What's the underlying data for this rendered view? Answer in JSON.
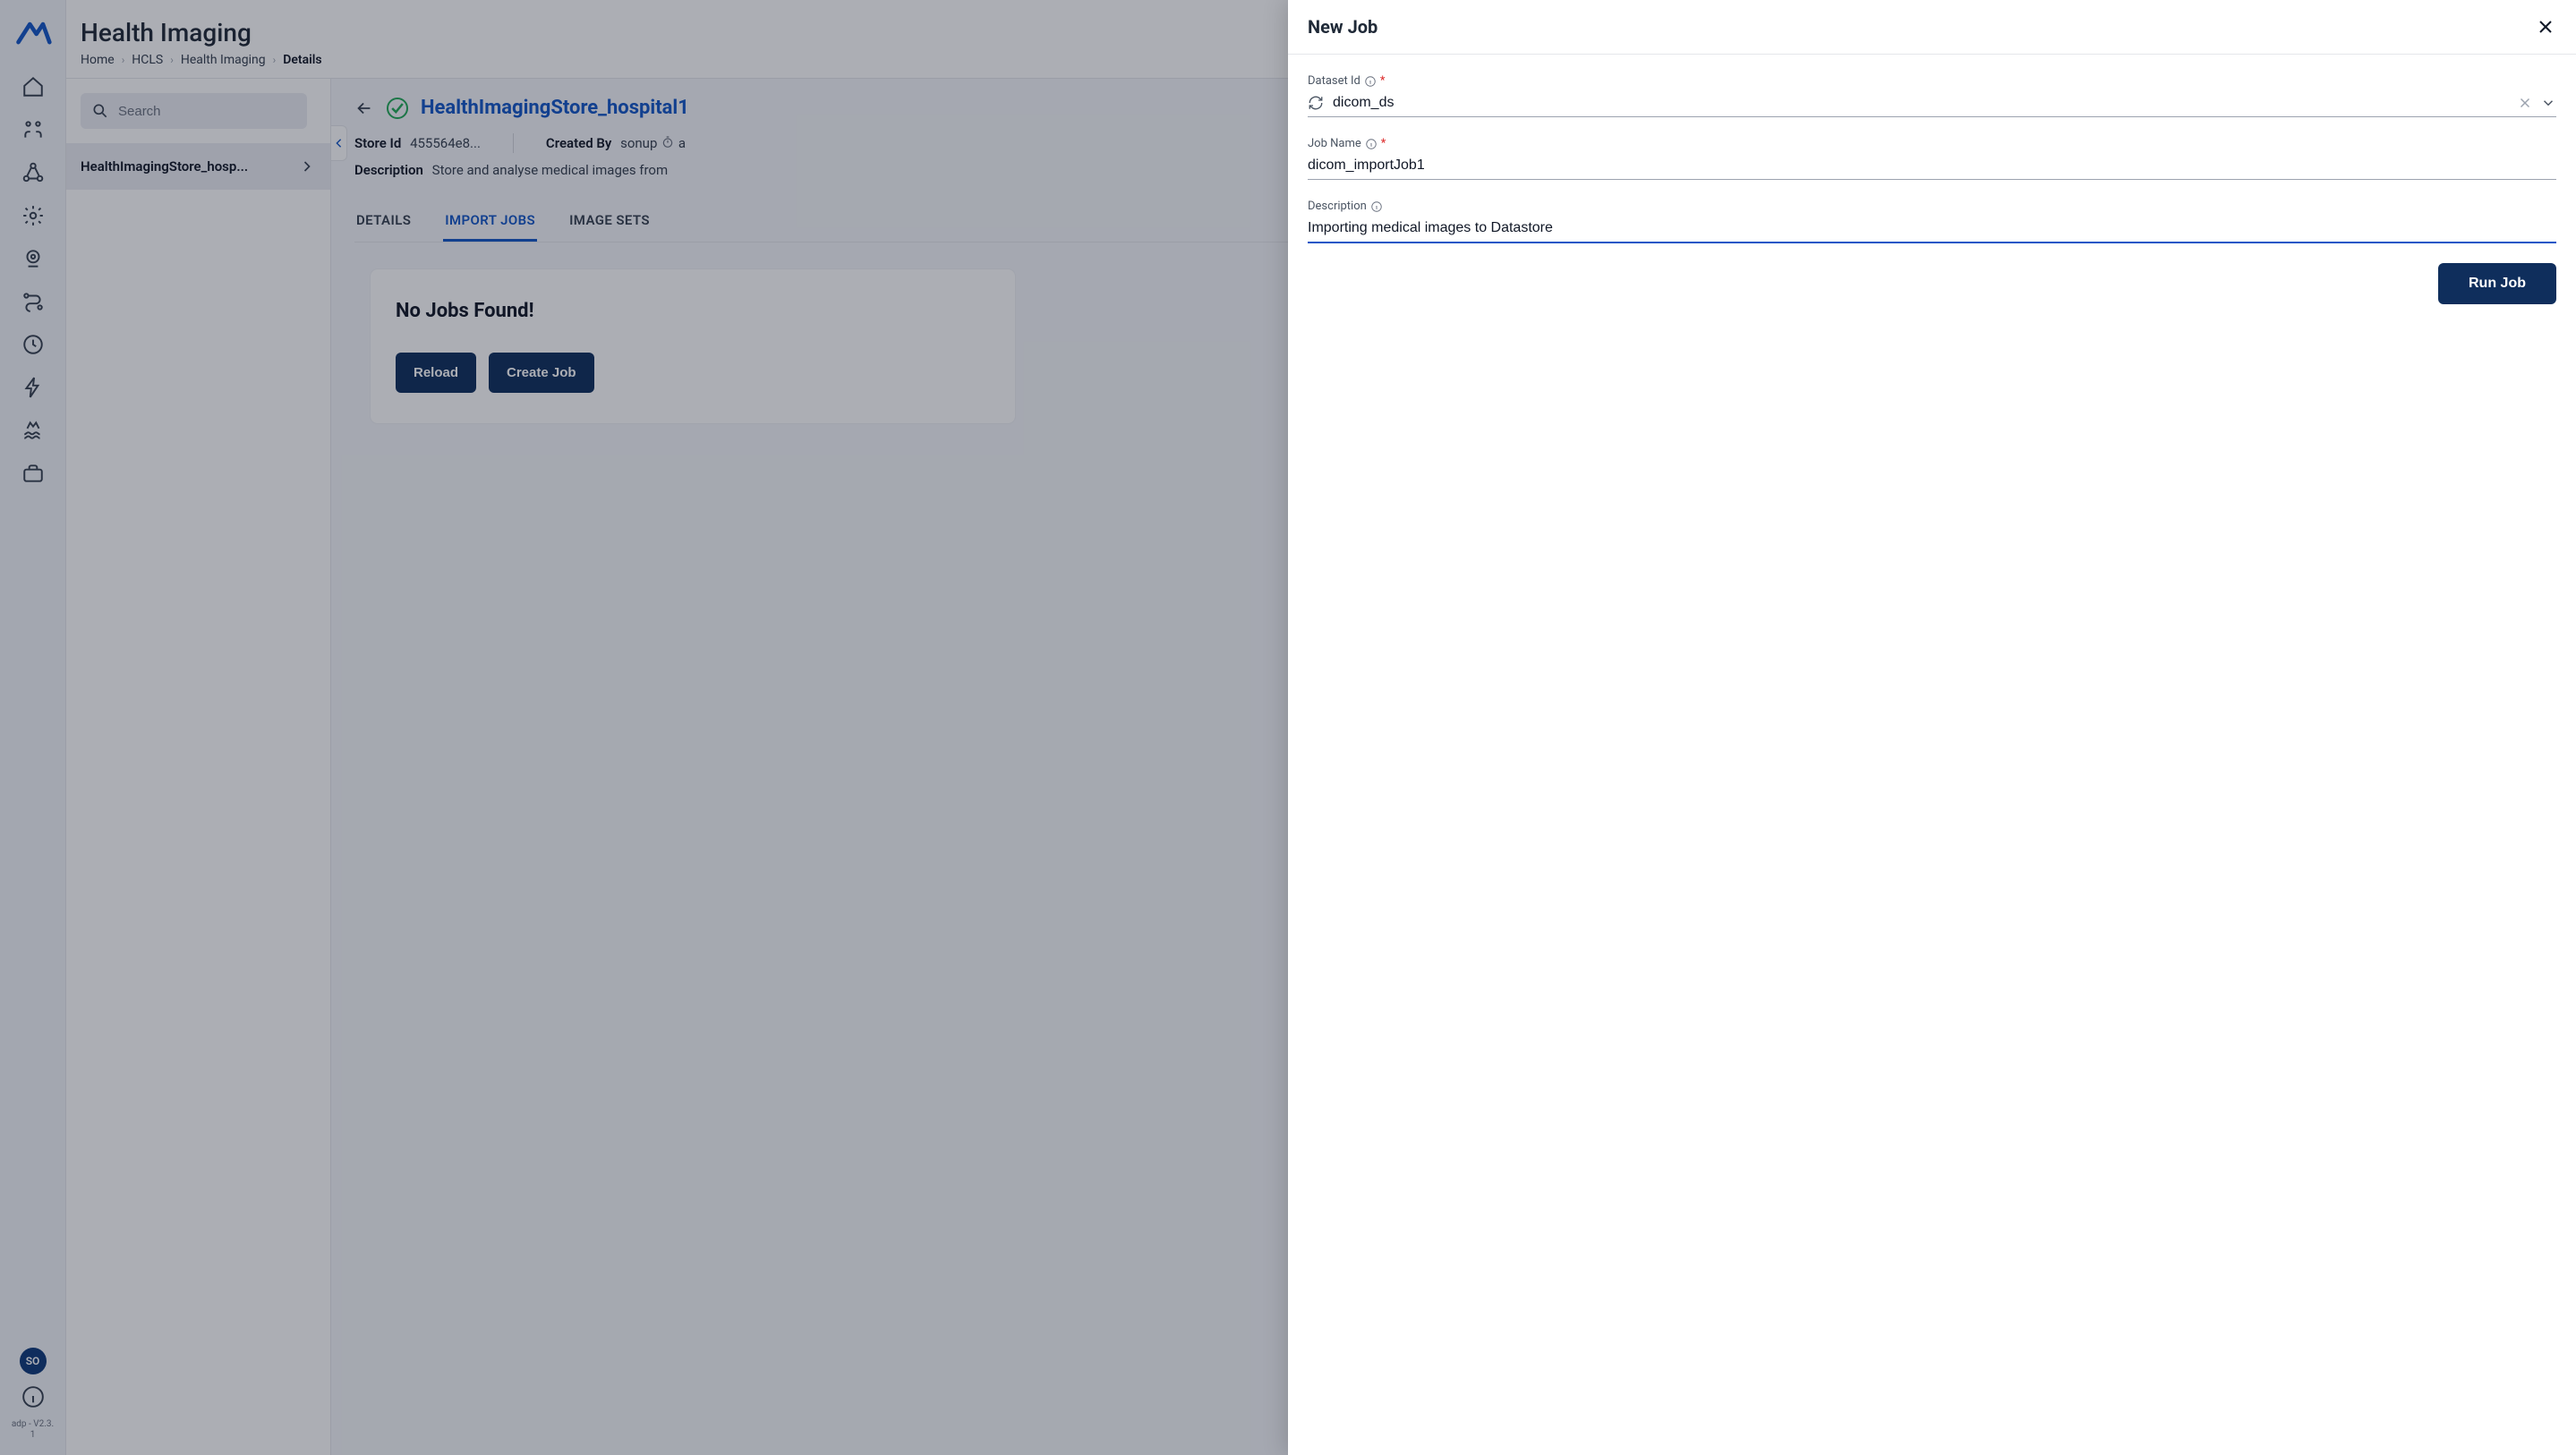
{
  "header": {
    "page_title": "Health Imaging",
    "breadcrumbs": [
      "Home",
      "HCLS",
      "Health Imaging",
      "Details"
    ]
  },
  "sidebar": {
    "avatar_initials": "SO",
    "version_line1": "adp - V2.3.",
    "version_line2": "1"
  },
  "list": {
    "search_placeholder": "Search",
    "items": [
      {
        "label": "HealthImagingStore_hosp..."
      }
    ]
  },
  "detail": {
    "title": "HealthImagingStore_hospital1",
    "store_id_label": "Store Id",
    "store_id_value": "455564e8...",
    "created_by_label": "Created By",
    "created_by_value": "sonup",
    "created_time_partial": "a",
    "description_label": "Description",
    "description_value": "Store and analyse medical images from",
    "tabs": [
      "DETAILS",
      "IMPORT JOBS",
      "IMAGE SETS"
    ],
    "active_tab_index": 1,
    "empty": {
      "title": "No Jobs Found!",
      "reload_label": "Reload",
      "create_label": "Create Job"
    }
  },
  "drawer": {
    "title": "New Job",
    "dataset_id_label": "Dataset Id",
    "dataset_id_value": "dicom_ds",
    "job_name_label": "Job Name",
    "job_name_value": "dicom_importJob1",
    "description_label": "Description",
    "description_value": "Importing medical images to Datastore",
    "run_label": "Run Job"
  }
}
